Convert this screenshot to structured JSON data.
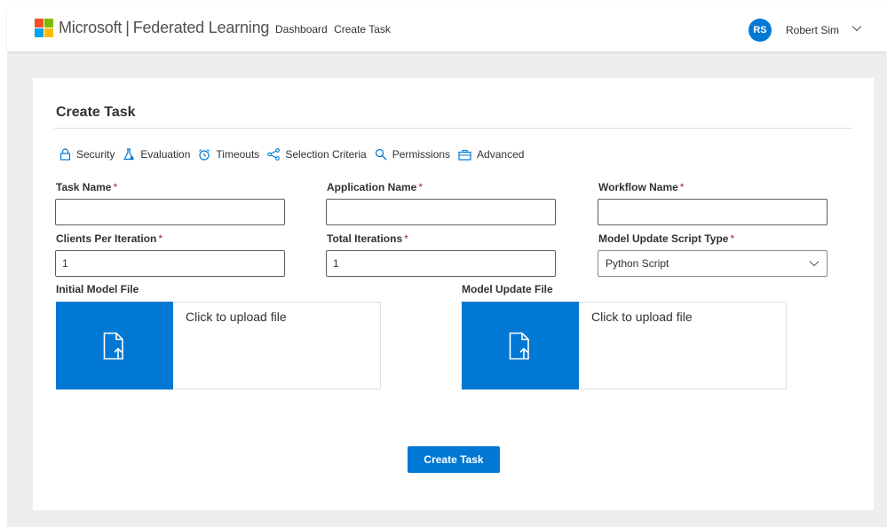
{
  "header": {
    "brand_company": "Microsoft",
    "brand_separator": "|",
    "brand_product": "Federated Learning",
    "nav": [
      {
        "label": "Dashboard"
      },
      {
        "label": "Create Task"
      }
    ],
    "user": {
      "initials": "RS",
      "name": "Robert Sim",
      "menu_icon": "chevron-down-icon"
    },
    "logo_colors": [
      "#f25022",
      "#7fba00",
      "#00a4ef",
      "#ffb900"
    ]
  },
  "form": {
    "title": "Create Task",
    "tabs": [
      {
        "label": "Security",
        "icon": "lock-icon"
      },
      {
        "label": "Evaluation",
        "icon": "flask-icon"
      },
      {
        "label": "Timeouts",
        "icon": "alarm-clock-icon"
      },
      {
        "label": "Selection Criteria",
        "icon": "share-nodes-icon"
      },
      {
        "label": "Permissions",
        "icon": "search-icon"
      },
      {
        "label": "Advanced",
        "icon": "briefcase-icon"
      }
    ],
    "fields": {
      "task_name": {
        "label": "Task Name",
        "required_mark": "*",
        "value": ""
      },
      "application_name": {
        "label": "Application Name",
        "required_mark": "*",
        "value": ""
      },
      "workflow_name": {
        "label": "Workflow Name",
        "required_mark": "*",
        "value": ""
      },
      "clients_per_iteration": {
        "label": "Clients Per Iteration",
        "required_mark": "*",
        "value": "1"
      },
      "total_iterations": {
        "label": "Total Iterations",
        "required_mark": "*",
        "value": "1"
      },
      "model_update_script_type": {
        "label": "Model Update Script Type",
        "required_mark": "*",
        "selected": "Python Script"
      }
    },
    "uploads": {
      "initial_model": {
        "label": "Initial Model File",
        "prompt": "Click to upload file",
        "icon": "file-upload-icon"
      },
      "model_update": {
        "label": "Model Update File",
        "prompt": "Click to upload file",
        "icon": "file-upload-icon"
      }
    },
    "submit_label": "Create Task"
  },
  "colors": {
    "accent": "#0078d4",
    "required": "#a4262c",
    "page_background": "#eeeeee"
  }
}
